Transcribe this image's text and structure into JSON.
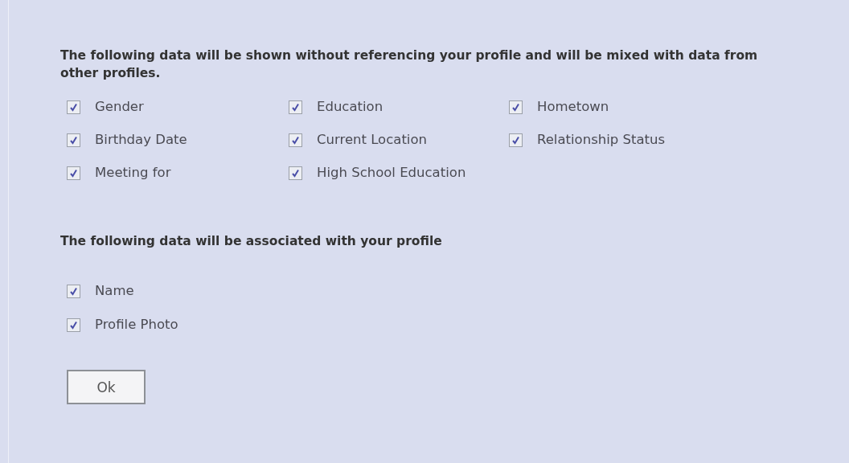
{
  "sections": [
    {
      "heading": "The following data will be shown without referencing your profile and will be mixed with data from other profiles.",
      "items": [
        {
          "label": "Gender",
          "checked": true
        },
        {
          "label": "Education",
          "checked": true
        },
        {
          "label": "Hometown",
          "checked": true
        },
        {
          "label": "Birthday Date",
          "checked": true
        },
        {
          "label": "Current Location",
          "checked": true
        },
        {
          "label": "Relationship Status",
          "checked": true
        },
        {
          "label": "Meeting for",
          "checked": true
        },
        {
          "label": "High School Education",
          "checked": true
        }
      ]
    },
    {
      "heading": "The following data will be associated with your profile",
      "items": [
        {
          "label": "Name",
          "checked": true
        },
        {
          "label": "Profile Photo",
          "checked": true
        }
      ]
    }
  ],
  "button": "Ok"
}
